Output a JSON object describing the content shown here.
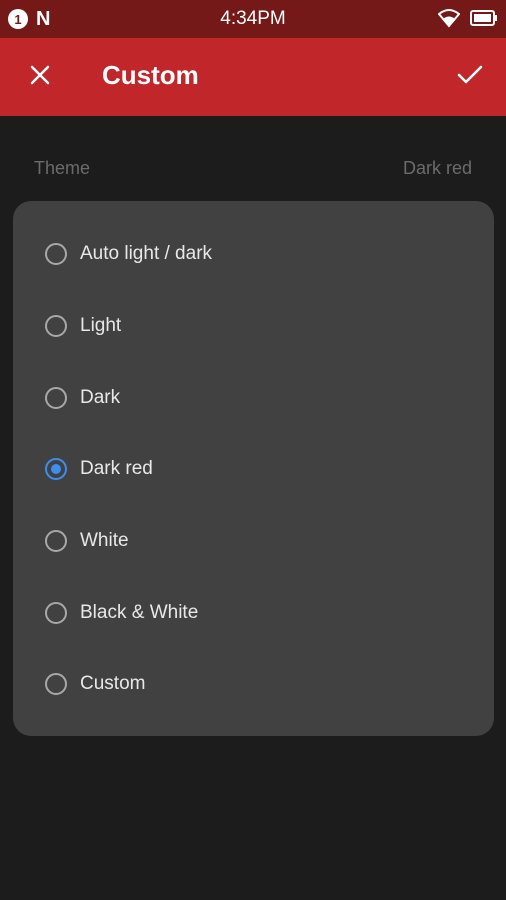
{
  "status_bar": {
    "notification_badge": "1",
    "carrier_logo": "N",
    "time": "4:34PM",
    "icons": [
      "wifi-icon",
      "battery-icon"
    ]
  },
  "app_bar": {
    "title": "Custom",
    "left_icon": "close-icon",
    "right_icon": "check-icon",
    "color": "#c0262a"
  },
  "setting": {
    "label": "Theme",
    "value": "Dark red"
  },
  "dialog": {
    "options": [
      {
        "label": "Auto light / dark",
        "selected": false
      },
      {
        "label": "Light",
        "selected": false
      },
      {
        "label": "Dark",
        "selected": false
      },
      {
        "label": "Dark red",
        "selected": true
      },
      {
        "label": "White",
        "selected": false
      },
      {
        "label": "Black & White",
        "selected": false
      },
      {
        "label": "Custom",
        "selected": false
      }
    ],
    "accent_color": "#3b8ff0"
  }
}
